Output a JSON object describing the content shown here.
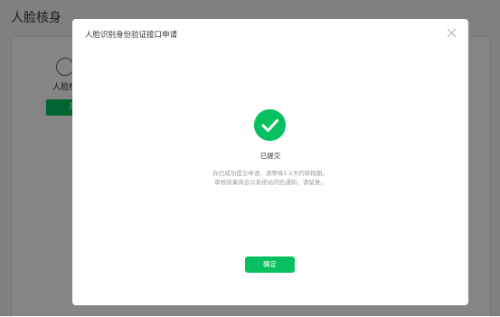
{
  "page": {
    "title": "人脸核身"
  },
  "service": {
    "label": "人脸核",
    "button_label": "开",
    "icon": "face-icon"
  },
  "modal": {
    "title": "人脸识别身份验证接口申请",
    "close_icon": "close-icon",
    "status_icon": "check-circle-icon",
    "status": "已提交",
    "description_line1": "你已成功提交申请，请等待1-2天的审核期。",
    "description_line2": "审核结果将会以系统站内信通知，请留意。",
    "confirm_label": "确定"
  },
  "colors": {
    "accent": "#07c160",
    "overlay": "rgba(0,0,0,0.48)"
  }
}
